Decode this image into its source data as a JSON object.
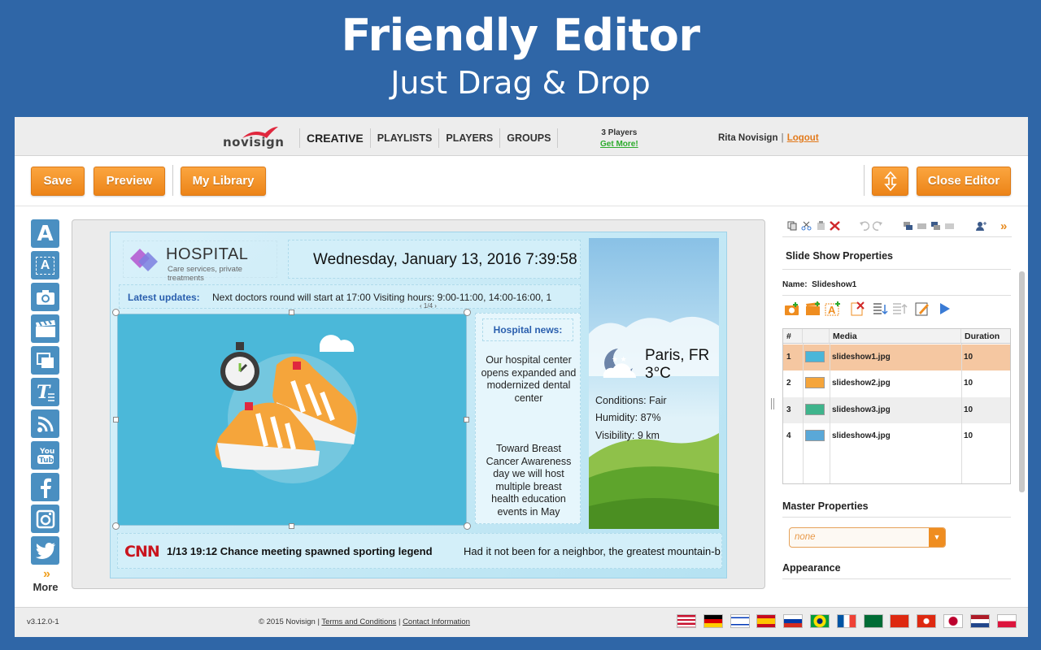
{
  "hero": {
    "title": "Friendly Editor",
    "subtitle": "Just Drag & Drop"
  },
  "nav": {
    "logo": "novisign",
    "links": [
      "CREATIVE",
      "PLAYLISTS",
      "PLAYERS",
      "GROUPS"
    ],
    "players_count": "3 Players",
    "get_more": "Get More!",
    "user": "Rita Novisign",
    "logout": "Logout"
  },
  "toolbar": {
    "save": "Save",
    "preview": "Preview",
    "library": "My Library",
    "close": "Close Editor"
  },
  "tools": {
    "more": "More"
  },
  "slide": {
    "hospital_name": "HOSPITAL",
    "hospital_tag": "Care services, private treatments",
    "datetime": "Wednesday, January 13, 2016 7:39:58",
    "updates_label": "Latest updates:",
    "updates_text": "Next doctors round will start at 17:00      Visiting hours: 9:00-11:00, 14:00-16:00, 1",
    "pager": "1/4",
    "news_heading": "Hospital news:",
    "news_1": "Our hospital center opens expanded and modernized dental center",
    "news_2": "Toward Breast Cancer Awareness day we will host multiple breast health education events in May",
    "weather": {
      "city": "Paris, FR",
      "temp": "3°C",
      "conditions": "Conditions:  Fair",
      "humidity": "Humidity:  87%",
      "visibility": "Visibility: 9 km"
    },
    "ticker_logo": "CNN",
    "ticker_headline": "1/13 19:12 Chance meeting spawned sporting legend",
    "ticker_text": "Had it not been for a neighbor, the greatest mountain-b"
  },
  "panel": {
    "title": "Slide Show Properties",
    "name_label": "Name:",
    "name_value": "Slideshow1",
    "columns": [
      "#",
      "Media",
      "Duration"
    ],
    "rows": [
      {
        "n": "1",
        "media": "slideshow1.jpg",
        "duration": "10"
      },
      {
        "n": "2",
        "media": "slideshow2.jpg",
        "duration": "10"
      },
      {
        "n": "3",
        "media": "slideshow3.jpg",
        "duration": "10"
      },
      {
        "n": "4",
        "media": "slideshow4.jpg",
        "duration": "10"
      }
    ],
    "master_title": "Master Properties",
    "master_value": "none",
    "appearance_title": "Appearance"
  },
  "footer": {
    "version": "v3.12.0-1",
    "copyright": "© 2015 Novisign |",
    "terms": "Terms and Conditions",
    "sep": "|",
    "contact": "Contact Information"
  },
  "colors": {
    "accent": "#ef8d20",
    "background": "#2f66a7",
    "tool_blue": "#4a8fc1",
    "selected_row": "#f5c7a1"
  }
}
